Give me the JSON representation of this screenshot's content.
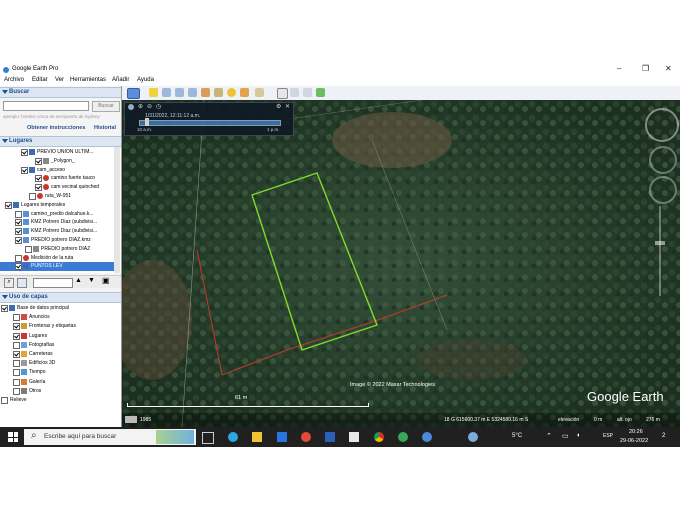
{
  "window": {
    "title": "Google Earth Pro",
    "min": "–",
    "max": "❐",
    "close": "✕"
  },
  "menu": [
    "Archivo",
    "Editar",
    "Ver",
    "Herramientas",
    "Añadir",
    "Ayuda"
  ],
  "search": {
    "header": "Buscar",
    "button": "Buscar",
    "placeholder": "ejemplo: hoteles cerca de aeropuerto de Sydney",
    "directions_link": "Obtener instrucciones",
    "history_link": "Historial"
  },
  "places": {
    "header": "Lugares",
    "items": [
      {
        "label": "PREVIO UNION ULTIM...",
        "indent": 30,
        "checked": true,
        "icon": "folder-icon"
      },
      {
        "label": "_Polygon_",
        "indent": 44,
        "checked": true,
        "icon": "polygon-icon"
      },
      {
        "label": "cam_acceso",
        "indent": 30,
        "checked": true,
        "icon": "folder-icon"
      },
      {
        "label": "camino fuerte tauco",
        "indent": 44,
        "checked": true,
        "icon": "path-icon"
      },
      {
        "label": "cam vecinal quinched",
        "indent": 44,
        "checked": true,
        "icon": "path-icon"
      },
      {
        "label": "ruta_W-951",
        "indent": 38,
        "checked": false,
        "icon": "path-icon"
      },
      {
        "label": "Lugares temporales",
        "indent": 14,
        "checked": true,
        "icon": "folder-icon"
      },
      {
        "label": "camino_predio dalcahue.k...",
        "indent": 24,
        "checked": false,
        "icon": "kmz-icon"
      },
      {
        "label": "KMZ Potrero Diaz (subdivisi...",
        "indent": 24,
        "checked": true,
        "icon": "kmz-icon"
      },
      {
        "label": "KMZ Potrero Diaz (subdivisi...",
        "indent": 24,
        "checked": true,
        "icon": "kmz-icon"
      },
      {
        "label": "PREDIO potrero DIAZ.kmz",
        "indent": 24,
        "checked": true,
        "icon": "kmz-icon"
      },
      {
        "label": "PREDIO potrero DIAZ",
        "indent": 34,
        "checked": false,
        "icon": "polygon-icon"
      },
      {
        "label": "Medición de la ruta",
        "indent": 24,
        "checked": false,
        "icon": "path-icon"
      },
      {
        "label": "PUNTOS LEV",
        "indent": 24,
        "checked": true,
        "icon": "folder-icon"
      }
    ]
  },
  "layers": {
    "header": "Uso de capas",
    "items": [
      {
        "label": "Base de datos principal",
        "indent": 10,
        "checked": true,
        "icon": "globe-icon"
      },
      {
        "label": "Anuncios",
        "indent": 22,
        "checked": false,
        "icon": "notice-icon"
      },
      {
        "label": "Fronteras y etiquetas",
        "indent": 22,
        "checked": true,
        "icon": "borders-icon"
      },
      {
        "label": "Lugares",
        "indent": 22,
        "checked": true,
        "icon": "places-icon"
      },
      {
        "label": "Fotografías",
        "indent": 22,
        "checked": false,
        "icon": "photo-icon"
      },
      {
        "label": "Carreteras",
        "indent": 22,
        "checked": true,
        "icon": "roads-icon"
      },
      {
        "label": "Edificios 3D",
        "indent": 22,
        "checked": false,
        "icon": "buildings-icon"
      },
      {
        "label": "Tiempo",
        "indent": 22,
        "checked": false,
        "icon": "weather-icon"
      },
      {
        "label": "Galería",
        "indent": 22,
        "checked": false,
        "icon": "gallery-icon"
      },
      {
        "label": "Otros",
        "indent": 22,
        "checked": false,
        "icon": "other-icon"
      },
      {
        "label": "Relieve",
        "indent": 10,
        "checked": false,
        "icon": ""
      }
    ]
  },
  "timeslider": {
    "date": "1/31/2022, 12:11:12 a.m.",
    "start": "10 a.m.",
    "end": "1 p.m."
  },
  "map": {
    "imagery_credit": "Image © 2022 Maxar Technologies",
    "brand": "Google Earth",
    "scale": "61 m",
    "year": "1985",
    "status": {
      "coords": "18 G 615600.37 m E 5324580.16 m S",
      "elevation_label": "elevación",
      "elevation": "0 m",
      "eye_label": "alt. ojo",
      "eye": "276 m"
    },
    "polygon_color": "#7fdc2a",
    "boundary_color": "#c43a2a"
  },
  "taskbar": {
    "search_placeholder": "Escribe aquí para buscar",
    "weather": "5°C",
    "lang": "ESP",
    "time": "20:26",
    "date": "29-06-2022",
    "notifications": "2"
  }
}
